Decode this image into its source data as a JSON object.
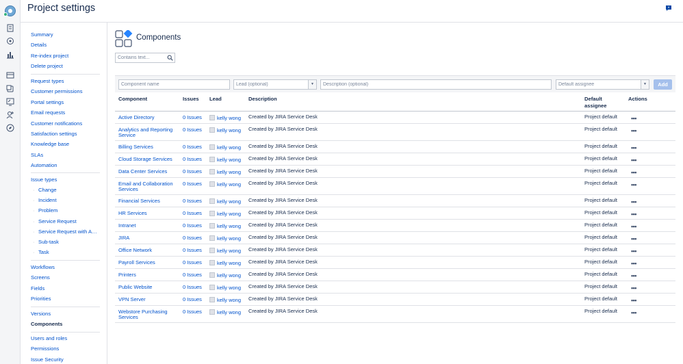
{
  "header": {
    "title": "Project settings"
  },
  "rail_icons": [
    "product-logo-icon",
    "board-icon",
    "component-icon",
    "reports-icon",
    "queues-icon",
    "shortcut-icon",
    "knowledge-base-icon",
    "invite-user-icon",
    "compass-icon"
  ],
  "nav": {
    "groups": [
      [
        "Summary",
        "Details",
        "Re-index project",
        "Delete project"
      ],
      [
        "Request types",
        "Customer permissions",
        "Portal settings",
        "Email requests",
        "Customer notifications",
        "Satisfaction settings",
        "Knowledge base",
        "SLAs",
        "Automation"
      ],
      [
        "Issue types"
      ],
      [
        "Workflows",
        "Screens",
        "Fields",
        "Priorities"
      ],
      [
        "Versions",
        "Components"
      ],
      [
        "Users and roles",
        "Permissions",
        "Issue Security"
      ]
    ],
    "issue_type_subitems": [
      "Change",
      "Incident",
      "Problem",
      "Service Request",
      "Service Request with A…",
      "Sub-task",
      "Task"
    ],
    "active": "Components"
  },
  "main": {
    "title": "Components",
    "search_placeholder": "Contains text...",
    "add_form": {
      "name_placeholder": "Component name",
      "lead_placeholder": "Lead (optional)",
      "description_placeholder": "Description (optional)",
      "assignee_value": "Default assignee",
      "add_label": "Add"
    },
    "columns": {
      "component": "Component",
      "issues": "Issues",
      "lead": "Lead",
      "description": "Description",
      "default_assignee_1": "Default",
      "default_assignee_2": "assignee",
      "actions": "Actions"
    },
    "rows": [
      {
        "name": [
          "Active Directory"
        ],
        "issues": "0 Issues",
        "lead": "kelly wong",
        "description": "Created by JIRA Service Desk",
        "default": "Project default"
      },
      {
        "name": [
          "Analytics and Reporting",
          "Service"
        ],
        "issues": "0 Issues",
        "lead": "kelly wong",
        "description": "Created by JIRA Service Desk",
        "default": "Project default"
      },
      {
        "name": [
          "Billing Services"
        ],
        "issues": "0 Issues",
        "lead": "kelly wong",
        "description": "Created by JIRA Service Desk",
        "default": "Project default"
      },
      {
        "name": [
          "Cloud Storage Services"
        ],
        "issues": "0 Issues",
        "lead": "kelly wong",
        "description": "Created by JIRA Service Desk",
        "default": "Project default"
      },
      {
        "name": [
          "Data Center Services"
        ],
        "issues": "0 Issues",
        "lead": "kelly wong",
        "description": "Created by JIRA Service Desk",
        "default": "Project default"
      },
      {
        "name": [
          "Email and Collaboration",
          "Services"
        ],
        "issues": "0 Issues",
        "lead": "kelly wong",
        "description": "Created by JIRA Service Desk",
        "default": "Project default"
      },
      {
        "name": [
          "Financial Services"
        ],
        "issues": "0 Issues",
        "lead": "kelly wong",
        "description": "Created by JIRA Service Desk",
        "default": "Project default"
      },
      {
        "name": [
          "HR Services"
        ],
        "issues": "0 Issues",
        "lead": "kelly wong",
        "description": "Created by JIRA Service Desk",
        "default": "Project default"
      },
      {
        "name": [
          "Intranet"
        ],
        "issues": "0 Issues",
        "lead": "kelly wong",
        "description": "Created by JIRA Service Desk",
        "default": "Project default"
      },
      {
        "name": [
          "JIRA"
        ],
        "issues": "0 Issues",
        "lead": "kelly wong",
        "description": "Created by JIRA Service Desk",
        "default": "Project default"
      },
      {
        "name": [
          "Office Network"
        ],
        "issues": "0 Issues",
        "lead": "kelly wong",
        "description": "Created by JIRA Service Desk",
        "default": "Project default"
      },
      {
        "name": [
          "Payroll Services"
        ],
        "issues": "0 Issues",
        "lead": "kelly wong",
        "description": "Created by JIRA Service Desk",
        "default": "Project default"
      },
      {
        "name": [
          "Printers"
        ],
        "issues": "0 Issues",
        "lead": "kelly wong",
        "description": "Created by JIRA Service Desk",
        "default": "Project default"
      },
      {
        "name": [
          "Public Website"
        ],
        "issues": "0 Issues",
        "lead": "kelly wong",
        "description": "Created by JIRA Service Desk",
        "default": "Project default"
      },
      {
        "name": [
          "VPN Server"
        ],
        "issues": "0 Issues",
        "lead": "kelly wong",
        "description": "Created by JIRA Service Desk",
        "default": "Project default"
      },
      {
        "name": [
          "Webstore Purchasing",
          "Services"
        ],
        "issues": "0 Issues",
        "lead": "kelly wong",
        "description": "Created by JIRA Service Desk",
        "default": "Project default"
      }
    ],
    "actions_glyph": "•••"
  },
  "colors": {
    "link": "#0052cc",
    "text": "#172b4d",
    "add_button": "#a5c0ec",
    "logo": "#6fa8d6"
  }
}
